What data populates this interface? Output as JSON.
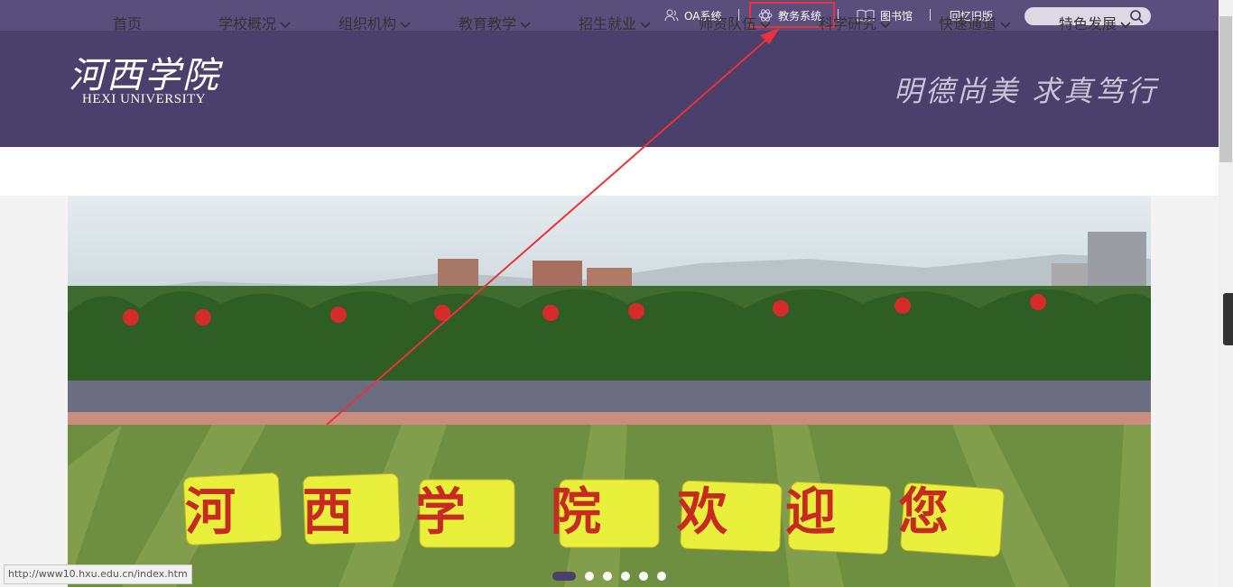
{
  "top_links": {
    "oa": "OA系统",
    "jiaowu": "教务系统",
    "library": "图书馆",
    "old_version": "回忆旧版"
  },
  "logo": {
    "cn": "河西学院",
    "en": "HEXI UNIVERSITY"
  },
  "motto": "明德尚美 求真笃行",
  "nav": [
    {
      "label": "首页"
    },
    {
      "label": "学校概况"
    },
    {
      "label": "组织机构"
    },
    {
      "label": "教育教学"
    },
    {
      "label": "招生就业"
    },
    {
      "label": "师资队伍"
    },
    {
      "label": "科学研究"
    },
    {
      "label": "快速通道"
    },
    {
      "label": "特色发展"
    }
  ],
  "banner": {
    "slogan": [
      "河",
      "西",
      "学",
      "院",
      "欢",
      "迎",
      "您"
    ]
  },
  "carousel": {
    "count": 6,
    "active_index": 0
  },
  "status_url": "http://www10.hxu.edu.cn/index.htm",
  "colors": {
    "topbar": "#5a4e7c",
    "header": "#4b3f6b",
    "highlight": "#e8333a"
  }
}
